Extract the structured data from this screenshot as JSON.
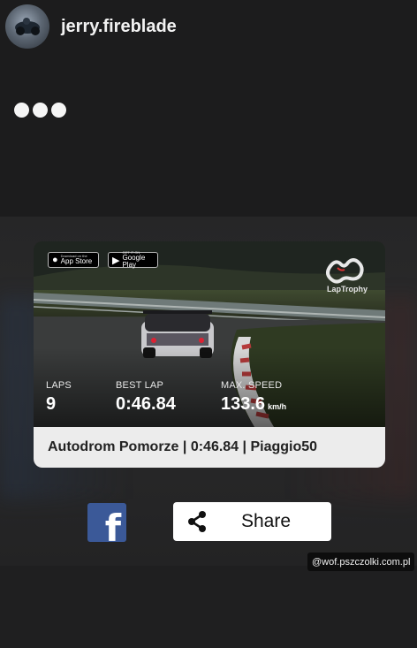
{
  "header": {
    "username": "jerry.fireblade"
  },
  "store_badges": [
    {
      "small": "Download on the",
      "big": "App Store"
    },
    {
      "small": "GET IT ON",
      "big": "Google Play"
    }
  ],
  "brand": {
    "name": "LapTrophy"
  },
  "stats": {
    "laps_label": "LAPS",
    "laps_value": "9",
    "best_lap_label": "BEST LAP",
    "best_lap_value": "0:46.84",
    "max_speed_label": "MAX. SPEED",
    "max_speed_value": "133.6",
    "max_speed_unit": "km/h"
  },
  "summary": "Autodrom Pomorze | 0:46.84 | Piaggio50",
  "actions": {
    "share_label": "Share",
    "facebook_glyph": "f"
  },
  "mention": "@wof.pszczolki.com.pl",
  "icons": [
    "facebook-icon",
    "share-icon",
    "apple-icon",
    "google-play-icon",
    "laptrophy-logo-icon"
  ],
  "colors": {
    "facebook": "#3b5998",
    "background": "#1f1f20",
    "card_footer": "#ececec"
  }
}
